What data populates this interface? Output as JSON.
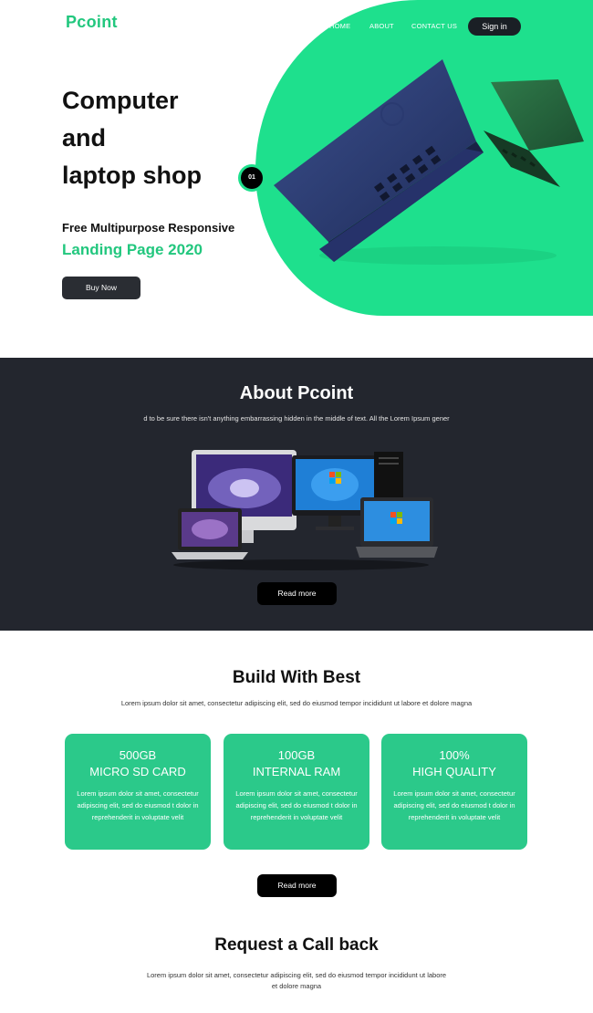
{
  "brand": {
    "logo": "Pcoint"
  },
  "nav": {
    "items": [
      "HOME",
      "ABOUT",
      "CONTACT US"
    ],
    "signin": "Sign in"
  },
  "hero": {
    "title_lines": [
      "Computer",
      "and",
      "laptop shop"
    ],
    "subtitle": "Free Multipurpose Responsive",
    "accent": "Landing Page 2020",
    "button": "Buy Now",
    "slide_number": "01"
  },
  "about": {
    "title": "About Pcoint",
    "text": "d to be sure there isn't anything embarrassing hidden in the middle of text. All the Lorem Ipsum gener",
    "button": "Read more"
  },
  "build": {
    "title": "Build With Best",
    "subtitle": "Lorem ipsum dolor sit amet, consectetur adipiscing elit, sed do eiusmod tempor incididunt ut labore et dolore magna",
    "cards": [
      {
        "top": "500GB",
        "bottom": "MICRO SD CARD",
        "text": "Lorem ipsum dolor sit amet, consectetur adipiscing elit, sed do eiusmod t dolor in reprehenderit in voluptate velit"
      },
      {
        "top": "100GB",
        "bottom": "INTERNAL RAM",
        "text": "Lorem ipsum dolor sit amet, consectetur adipiscing elit, sed do eiusmod t dolor in reprehenderit in voluptate velit"
      },
      {
        "top": "100%",
        "bottom": "HIGH QUALITY",
        "text": "Lorem ipsum dolor sit amet, consectetur adipiscing elit, sed do eiusmod t dolor in reprehenderit in voluptate velit"
      }
    ],
    "button": "Read more"
  },
  "callback": {
    "title": "Request a Call back",
    "text": "Lorem ipsum dolor sit amet, consectetur adipiscing elit, sed do eiusmod tempor incididunt ut labore et dolore magna"
  },
  "colors": {
    "accent_green": "#1ee08d",
    "card_green": "#2bc98a",
    "dark_section": "#23262e",
    "button_dark": "#000000"
  }
}
